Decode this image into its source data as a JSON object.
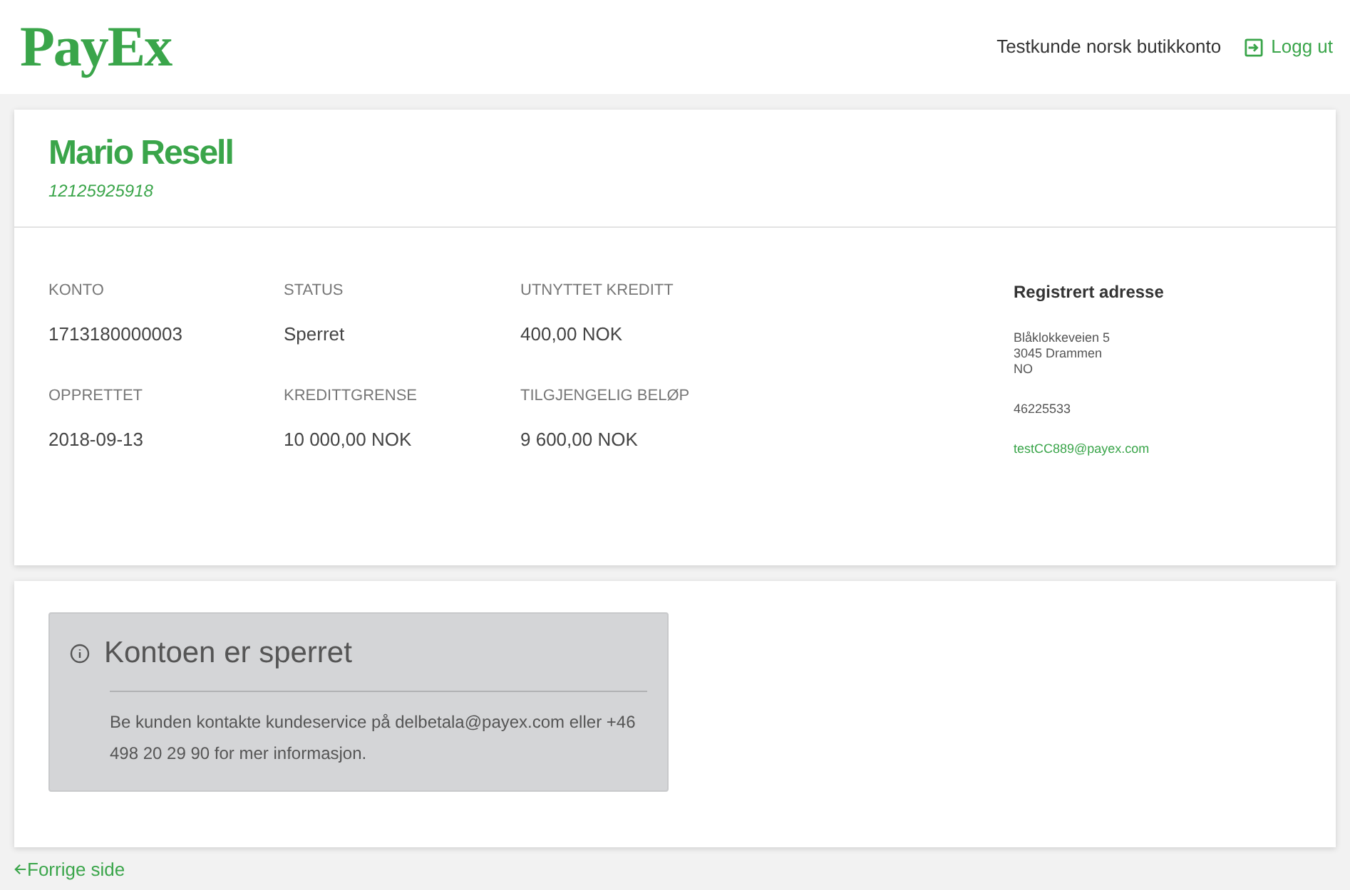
{
  "header": {
    "logo": "PayEx",
    "store_name": "Testkunde norsk butikkonto",
    "logout": "Logg ut"
  },
  "customer": {
    "name": "Mario Resell",
    "id": "12125925918"
  },
  "fields": [
    {
      "label": "KONTO",
      "value": "1713180000003"
    },
    {
      "label": "STATUS",
      "value": "Sperret"
    },
    {
      "label": "UTNYTTET KREDITT",
      "value": "400,00 NOK"
    },
    {
      "label": "OPPRETTET",
      "value": "2018-09-13"
    },
    {
      "label": "KREDITTGRENSE",
      "value": "10 000,00 NOK"
    },
    {
      "label": "TILGJENGELIG BELØP",
      "value": "9 600,00 NOK"
    }
  ],
  "address": {
    "title": "Registrert adresse",
    "lines": [
      "Blåklokkeveien 5",
      "3045 Drammen",
      "NO"
    ],
    "phone": "46225533",
    "email": "testCC889@payex.com"
  },
  "notice": {
    "title": "Kontoen er sperret",
    "text": "Be kunden kontakte kundeservice på delbetala@payex.com eller +46 498 20 29 90 for mer informasjon."
  },
  "back_link": "Forrige side"
}
